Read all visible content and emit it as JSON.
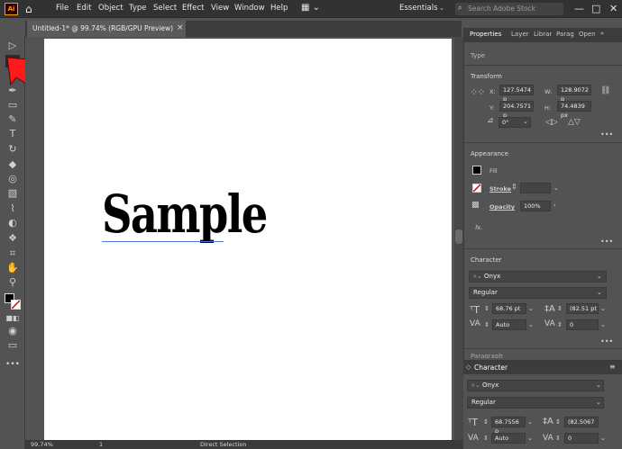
{
  "app": {
    "logo": "Ai"
  },
  "menu": [
    "File",
    "Edit",
    "Object",
    "Type",
    "Select",
    "Effect",
    "View",
    "Window",
    "Help"
  ],
  "workspace": "Essentials",
  "search_placeholder": "Search Adobe Stock",
  "window_controls": {
    "minimize": "—",
    "maximize": "□",
    "close": "✕"
  },
  "document_tab": {
    "title": "Untitled-1* @ 99.74% (RGB/GPU Preview)",
    "close": "×"
  },
  "canvas": {
    "text": "Sample"
  },
  "statusbar": {
    "zoom": "99.74%",
    "page": "1",
    "tool": "Direct Selection"
  },
  "panel": {
    "tabs": [
      "Properties",
      "Layers",
      "Libraries",
      "Paragraph",
      "OpenType"
    ],
    "type_label": "Type",
    "transform": {
      "title": "Transform",
      "x_label": "X:",
      "x": "127.5474 p",
      "y_label": "Y:",
      "y": "204.7571 p",
      "w_label": "W:",
      "w": "128.9072 p",
      "h_label": "H:",
      "h": "74.4839 px",
      "rotate": "0°"
    },
    "appearance": {
      "title": "Appearance",
      "fill": "Fill",
      "stroke": "Stroke",
      "opacity": "Opacity",
      "opacity_value": "100%",
      "fx": "fx."
    },
    "character": {
      "title": "Character",
      "font": "Onyx",
      "style": "Regular",
      "size": "68.76 pt",
      "leading": "(82.51 pt",
      "kerning": "Auto",
      "tracking": "0"
    },
    "paragraph_title": "Paragraph"
  },
  "char_panel": {
    "title": "Character",
    "font": "Onyx",
    "style": "Regular",
    "size": "68.7556 p",
    "leading": "(82.5067",
    "kerning": "Auto",
    "tracking": "0"
  },
  "colors": {
    "arrow": "#ff1a1a",
    "fill": "#000000",
    "stroke_none": "#d40000"
  }
}
